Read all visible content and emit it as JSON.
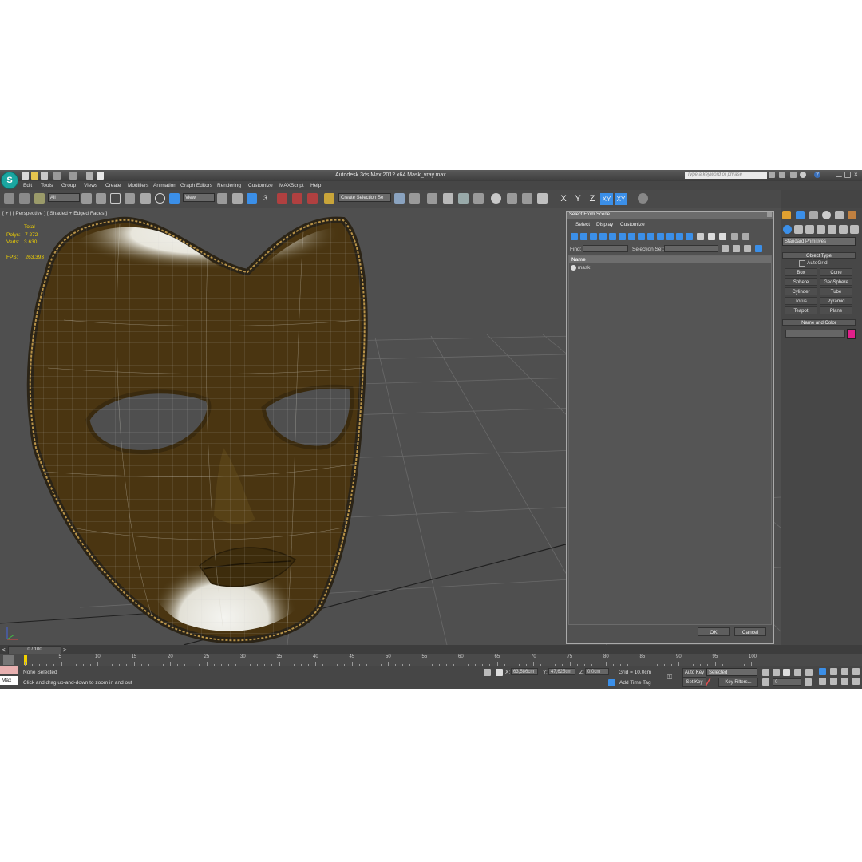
{
  "window": {
    "app_title": "Autodesk 3ds Max  2012 x64     Mask_vray.max",
    "search_placeholder": "Type a keyword or phrase",
    "help_icon": "?"
  },
  "menus": [
    "Edit",
    "Tools",
    "Group",
    "Views",
    "Create",
    "Modifiers",
    "Animation",
    "Graph Editors",
    "Rendering",
    "Customize",
    "MAXScript",
    "Help"
  ],
  "toolbar": {
    "filter": "All",
    "ref_coord": "View",
    "selection_set": "Create Selection Se",
    "snap_label": "3",
    "axis_x": "X",
    "axis_y": "Y",
    "axis_z": "Z",
    "axis_xy": "XY",
    "axis_xy2": "XY"
  },
  "viewport": {
    "label": "[ + ] [ Perspective ] [ Shaded + Edged Faces ]",
    "stats_total": "Total",
    "polys_label": "Polys:",
    "polys": "7 272",
    "verts_label": "Verts:",
    "verts": "3 630",
    "fps_label": "FPS:",
    "fps": "263,393"
  },
  "dialog": {
    "title": "Select From Scene",
    "menus": [
      "Select",
      "Display",
      "Customize"
    ],
    "find_label": "Find:",
    "selection_set_label": "Selection Set:",
    "column_name": "Name",
    "items": [
      "mask"
    ],
    "ok": "OK",
    "cancel": "Cancel"
  },
  "command_panel": {
    "category": "Standard Primitives",
    "object_type_title": "Object Type",
    "autogrid": "AutoGrid",
    "primitives": [
      "Box",
      "Cone",
      "Sphere",
      "GeoSphere",
      "Cylinder",
      "Tube",
      "Torus",
      "Pyramid",
      "Teapot",
      "Plane"
    ],
    "name_color_title": "Name and Color",
    "object_color": "#e0208a"
  },
  "timeline": {
    "frame_counter": "0 / 100",
    "ticks": [
      "5",
      "10",
      "15",
      "20",
      "25",
      "30",
      "35",
      "40",
      "45",
      "50",
      "55",
      "60",
      "65",
      "70",
      "75",
      "80",
      "85",
      "90",
      "95",
      "100"
    ]
  },
  "status": {
    "selection": "None Selected",
    "prompt": "Click and drag up-and-down to zoom in and out",
    "maxscript_label": "Max",
    "x_label": "X:",
    "x_value": "63,586cm",
    "y_label": "Y:",
    "y_value": "47,625cm",
    "z_label": "Z:",
    "z_value": "0,0cm",
    "grid": "Grid = 10,0cm",
    "add_time_tag": "Add Time Tag",
    "auto_key": "Auto Key",
    "set_key": "Set Key",
    "key_mode": "Selected",
    "key_filters": "Key Filters...",
    "current_frame": "0"
  },
  "colors": {
    "accent_blue": "#3b8fe8",
    "stats_yellow": "#f2d200",
    "grid_frame": "#c8a238"
  }
}
